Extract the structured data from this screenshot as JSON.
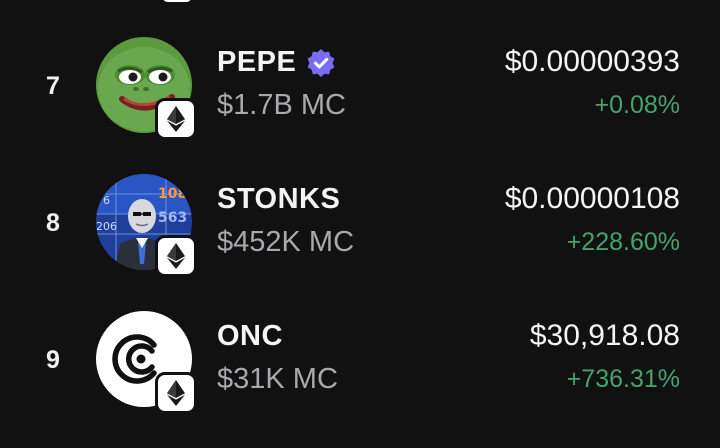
{
  "colors": {
    "background": "#111112",
    "positive": "#45a36b",
    "secondary_text": "#a8a8ad",
    "verified": "#7b6cf6"
  },
  "tokens": [
    {
      "rank": "7",
      "name": "PEPE",
      "verified": true,
      "market_cap": "$1.7B MC",
      "price": "$0.00000393",
      "change": "+0.08%",
      "avatar_icon": "pepe-frog-avatar-icon",
      "chain_icon": "ethereum-icon"
    },
    {
      "rank": "8",
      "name": "STONKS",
      "verified": false,
      "market_cap": "$452K MC",
      "price": "$0.00000108",
      "change": "+228.60%",
      "avatar_icon": "stonks-man-avatar-icon",
      "chain_icon": "ethereum-icon"
    },
    {
      "rank": "9",
      "name": "ONC",
      "verified": false,
      "market_cap": "$31K MC",
      "price": "$30,918.08",
      "change": "+736.31%",
      "avatar_icon": "onc-logo-avatar-icon",
      "chain_icon": "ethereum-icon"
    }
  ]
}
